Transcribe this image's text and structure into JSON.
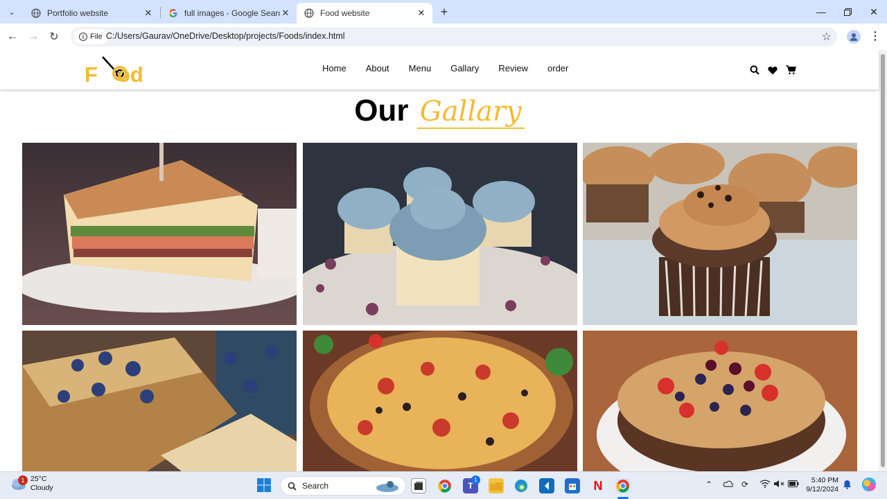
{
  "browser": {
    "tabs": [
      {
        "title": "Portfolio website",
        "active": false
      },
      {
        "title": "full images - Google Search",
        "active": false
      },
      {
        "title": "Food website",
        "active": true
      }
    ],
    "address": {
      "chip_label": "File",
      "url": "C:/Users/Gaurav/OneDrive/Desktop/projects/Foods/index.html"
    }
  },
  "site": {
    "logo": {
      "text_before": "F",
      "text_after": "od"
    },
    "nav": [
      "Home",
      "About",
      "Menu",
      "Gallary",
      "Review",
      "order"
    ],
    "heading": {
      "lead": "Our",
      "accent": "Gallary"
    },
    "accent_color": "#f1bc33",
    "gallery": [
      {
        "name": "sandwich-photo"
      },
      {
        "name": "blue-cupcakes-photo"
      },
      {
        "name": "chocolate-cupcakes-photo"
      },
      {
        "name": "blueberry-bread-photo"
      },
      {
        "name": "pizza-photo"
      },
      {
        "name": "berry-cake-photo"
      }
    ]
  },
  "taskbar": {
    "weather": {
      "temp": "25°C",
      "condition": "Cloudy",
      "badge": "1"
    },
    "search_placeholder": "Search",
    "teams_badge": "1",
    "clock": {
      "time": "5:40 PM",
      "date": "9/12/2024"
    }
  }
}
